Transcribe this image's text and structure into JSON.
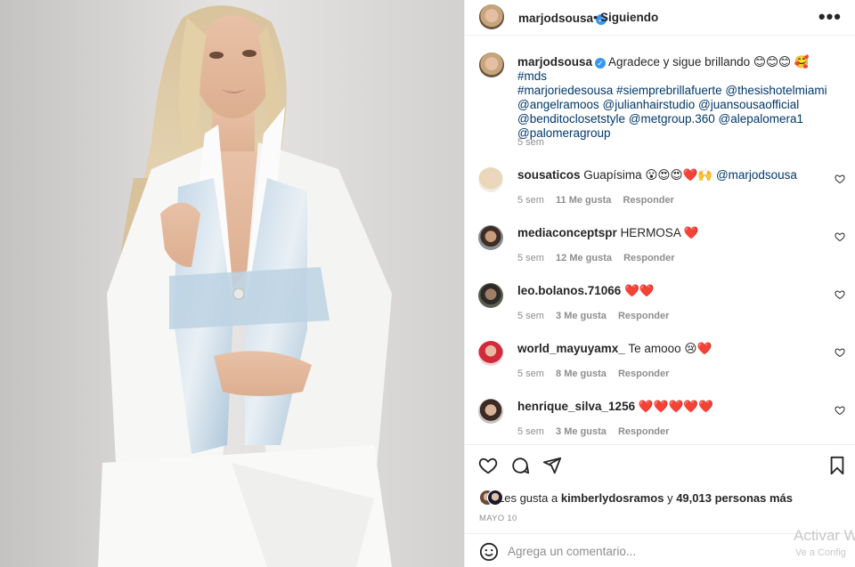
{
  "post": {
    "username": "marjodsousa",
    "separator": "•",
    "follow_status": "Siguiendo",
    "more": "•••"
  },
  "caption": {
    "username": "marjodsousa",
    "text": "Agradece y sigue brillando 😊😊😊 🥰",
    "hashtags": "#mds #marjoriedesousa #siempre brillafuerte",
    "line1_tags": "#mds",
    "line2": "#marjoriedesousa #siemprebrillafuerte @thesishotelmiami",
    "line3": "@angelramoos @julianhairstudio @juansousaofficial",
    "line4": "@benditoclosetstyle @metgroup.360 @alepalomera1",
    "line5": "@palomeragroup",
    "time": "5 sem"
  },
  "comments": [
    {
      "username": "sousaticos",
      "text": "Guapísima 😮😍😍❤️🙌",
      "mention": "@marjodsousa",
      "time": "5 sem",
      "likes": "11 Me gusta",
      "reply": "Responder"
    },
    {
      "username": "mediaconceptspr",
      "text": "HERMOSA ❤️",
      "mention": "",
      "time": "5 sem",
      "likes": "12 Me gusta",
      "reply": "Responder"
    },
    {
      "username": "leo.bolanos.71066",
      "text": "❤️❤️",
      "mention": "",
      "time": "5 sem",
      "likes": "3 Me gusta",
      "reply": "Responder"
    },
    {
      "username": "world_mayuyamx_",
      "text": "Te amooo 😢❤️",
      "mention": "",
      "time": "5 sem",
      "likes": "8 Me gusta",
      "reply": "Responder"
    },
    {
      "username": "henrique_silva_1256",
      "text": "❤️❤️❤️❤️❤️",
      "mention": "",
      "time": "5 sem",
      "likes": "3 Me gusta",
      "reply": "Responder"
    }
  ],
  "likes": {
    "prefix": "Les gusta a",
    "user": "kimberlydosramos",
    "connector": "y",
    "count": "49,013 personas más"
  },
  "date": "MAYO 10",
  "comment_input": {
    "placeholder": "Agrega un comentario..."
  },
  "watermark": {
    "line1": "Activar W",
    "line2": "Ve a Config"
  },
  "icons": [
    "more-icon",
    "verified-icon",
    "heart-icon",
    "comment-icon",
    "share-icon",
    "bookmark-icon",
    "emoji-icon"
  ],
  "colors": {
    "link": "#00376b",
    "verified": "#3897f0",
    "muted": "#8e8e8e",
    "heart": "#ed1c3a"
  }
}
